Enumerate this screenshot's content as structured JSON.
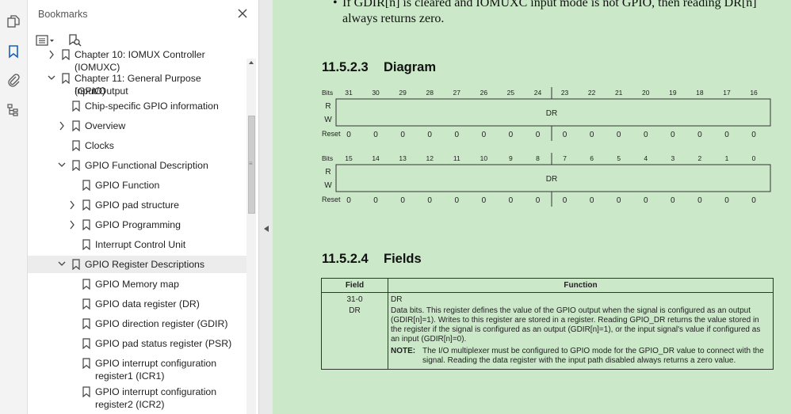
{
  "toolbar": {
    "icons": [
      "pages-icon",
      "bookmark-icon",
      "attachment-icon",
      "structure-icon"
    ]
  },
  "panel": {
    "title": "Bookmarks",
    "close_icon": "close-icon",
    "options_icon": "options-menu-icon",
    "find_icon": "find-bookmark-icon"
  },
  "bookmarks": [
    {
      "label": "Chapter 10: IOMUX Controller (IOMUXC)",
      "level": 0,
      "arrow": "right"
    },
    {
      "label": "Chapter 11: General Purpose Input/Output",
      "label2": "(GPIO)",
      "level": 0,
      "arrow": "down"
    },
    {
      "label": "Chip-specific GPIO information",
      "level": 1,
      "arrow": "none"
    },
    {
      "label": "Overview",
      "level": 1,
      "arrow": "right"
    },
    {
      "label": "Clocks",
      "level": 1,
      "arrow": "none"
    },
    {
      "label": "GPIO Functional Description",
      "level": 1,
      "arrow": "down"
    },
    {
      "label": "GPIO Function",
      "level": 2,
      "arrow": "none"
    },
    {
      "label": "GPIO pad structure",
      "level": 2,
      "arrow": "right"
    },
    {
      "label": "GPIO Programming",
      "level": 2,
      "arrow": "right"
    },
    {
      "label": "Interrupt Control Unit",
      "level": 2,
      "arrow": "none"
    },
    {
      "label": "GPIO Register Descriptions",
      "level": 1,
      "arrow": "down",
      "selected": true
    },
    {
      "label": "GPIO Memory map",
      "level": 2,
      "arrow": "none"
    },
    {
      "label": "GPIO data register (DR)",
      "level": 2,
      "arrow": "none"
    },
    {
      "label": "GPIO direction register (GDIR)",
      "level": 2,
      "arrow": "none"
    },
    {
      "label": "GPIO pad status register (PSR)",
      "level": 2,
      "arrow": "none"
    },
    {
      "label": "GPIO interrupt configuration",
      "label2": "register1 (ICR1)",
      "level": 2,
      "arrow": "none"
    },
    {
      "label": "GPIO interrupt configuration",
      "label2": "register2 (ICR2)",
      "level": 2,
      "arrow": "none"
    }
  ],
  "document": {
    "top_text_line1": "If GDIR[n] is cleared and IOMUXC input mode is not GPIO, then reading DR[n]",
    "top_text_line2": "always returns zero.",
    "diagram_heading_num": "11.5.2.3",
    "diagram_heading": "Diagram",
    "register": {
      "bits_label": "Bits",
      "r_label": "R",
      "w_label": "W",
      "reset_label": "Reset",
      "field_name": "DR",
      "upper_bits": [
        "31",
        "30",
        "29",
        "28",
        "27",
        "26",
        "25",
        "24",
        "23",
        "22",
        "21",
        "20",
        "19",
        "18",
        "17",
        "16"
      ],
      "lower_bits": [
        "15",
        "14",
        "13",
        "12",
        "11",
        "10",
        "9",
        "8",
        "7",
        "6",
        "5",
        "4",
        "3",
        "2",
        "1",
        "0"
      ],
      "reset_values": [
        "0",
        "0",
        "0",
        "0",
        "0",
        "0",
        "0",
        "0",
        "0",
        "0",
        "0",
        "0",
        "0",
        "0",
        "0",
        "0"
      ]
    },
    "fields_heading_num": "11.5.2.4",
    "fields_heading": "Fields",
    "fields_table": {
      "col_field": "Field",
      "col_function": "Function",
      "bits": "31-0",
      "name": "DR",
      "func_title": "DR",
      "func_desc": "Data bits. This register defines the value of the GPIO output when the signal is configured as an output (GDIR[n]=1). Writes to this register are stored in a register. Reading GPIO_DR returns the value stored in the register if the signal is configured as an output (GDIR[n]=1), or the input signal's value if configured as an input (GDIR[n]=0).",
      "note_label": "NOTE:",
      "note_text": "The I/O multiplexer must be configured to GPIO mode for the GPIO_DR value to connect with the signal. Reading the data register with the input path disabled always returns a zero value."
    }
  }
}
